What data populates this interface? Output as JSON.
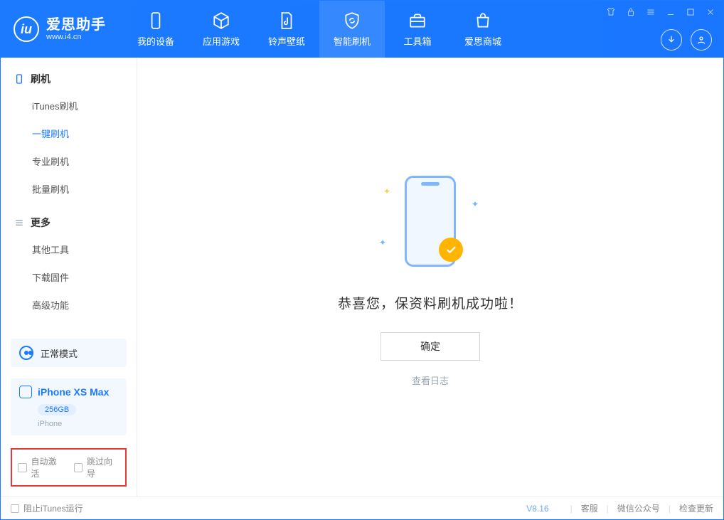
{
  "logo": {
    "cn": "爱思助手",
    "url": "www.i4.cn"
  },
  "nav": [
    {
      "label": "我的设备"
    },
    {
      "label": "应用游戏"
    },
    {
      "label": "铃声壁纸"
    },
    {
      "label": "智能刷机"
    },
    {
      "label": "工具箱"
    },
    {
      "label": "爱思商城"
    }
  ],
  "sidebar": {
    "group_flash": "刷机",
    "items_flash": [
      "iTunes刷机",
      "一键刷机",
      "专业刷机",
      "批量刷机"
    ],
    "group_more": "更多",
    "items_more": [
      "其他工具",
      "下载固件",
      "高级功能"
    ]
  },
  "mode": {
    "label": "正常模式"
  },
  "device": {
    "name": "iPhone XS Max",
    "capacity": "256GB",
    "type": "iPhone"
  },
  "options": {
    "auto_activate": "自动激活",
    "skip_guide": "跳过向导"
  },
  "main": {
    "success": "恭喜您，保资料刷机成功啦！",
    "ok": "确定",
    "view_log": "查看日志"
  },
  "footer": {
    "block_itunes": "阻止iTunes运行",
    "version": "V8.16",
    "links": [
      "客服",
      "微信公众号",
      "检查更新"
    ]
  }
}
